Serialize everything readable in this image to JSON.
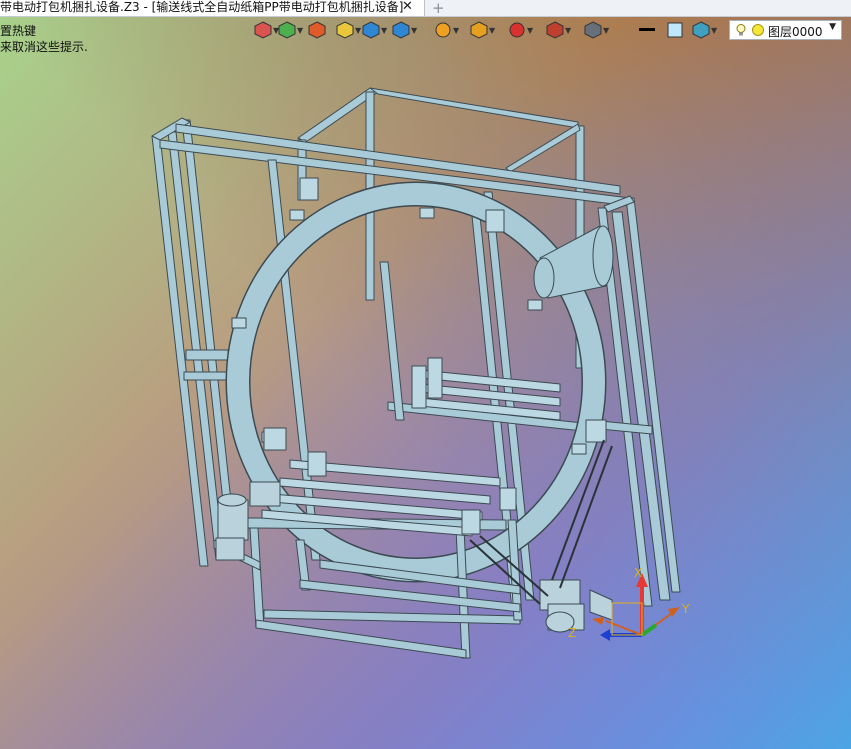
{
  "tab": {
    "title": "带电动打包机捆扎设备.Z3 - [输送线式全自动纸箱PP带电动打包机捆扎设备]",
    "close_glyph": "✕",
    "add_glyph": "+"
  },
  "messages": {
    "line1": "置热键",
    "line2": "来取消这些提示."
  },
  "toolbar": {
    "buttons": [
      {
        "name": "exit-sketch-icon",
        "color": "#d9534f"
      },
      {
        "name": "feature-icon",
        "color": "#4caf50"
      },
      {
        "name": "line-tool-icon",
        "color": "#e05a2a"
      },
      {
        "name": "solid-box-icon",
        "color": "#e8c83a"
      },
      {
        "name": "solid-cube-icon",
        "color": "#2f86d3"
      },
      {
        "name": "view-cube-icon",
        "color": "#2f86d3"
      },
      {
        "name": "render-mode-icon",
        "color": "#f0a020"
      },
      {
        "name": "view-fit-icon",
        "color": "#e6a020"
      },
      {
        "name": "axis-icon",
        "color": "#d93030"
      },
      {
        "name": "dimension-icon",
        "color": "#c04030"
      },
      {
        "name": "display-icon",
        "color": "#666f7a"
      },
      {
        "name": "line-style-icon",
        "color": "#000000"
      },
      {
        "name": "color-icon",
        "color": "#bfe8ff"
      },
      {
        "name": "material-icon",
        "color": "#3fa0c0"
      }
    ]
  },
  "layer": {
    "value": "图层0000"
  },
  "triad": {
    "x_label": "X",
    "y_label": "Y",
    "z_label": "Z"
  }
}
